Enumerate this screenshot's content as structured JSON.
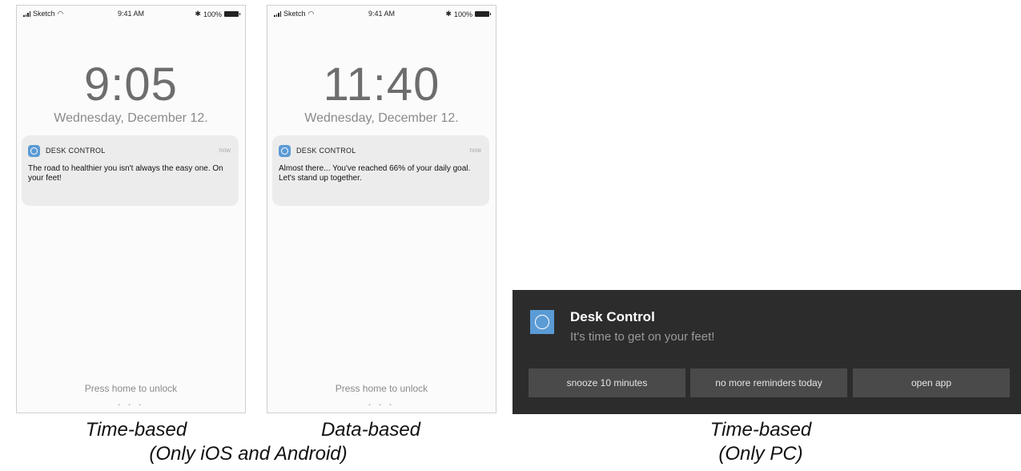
{
  "phones": [
    {
      "status": {
        "carrier": "Sketch",
        "time": "9:41 AM",
        "battery": "100%"
      },
      "lock_time": "9:05",
      "lock_date": "Wednesday, December 12.",
      "notification": {
        "app_name": "DESK CONTROL",
        "time": "now",
        "body": "The road to healthier you isn't always the easy one. On your feet!"
      },
      "unlock_hint": "Press home to unlock",
      "page_dots": "• • •"
    },
    {
      "status": {
        "carrier": "Sketch",
        "time": "9:41 AM",
        "battery": "100%"
      },
      "lock_time": "11:40",
      "lock_date": "Wednesday, December 12.",
      "notification": {
        "app_name": "DESK CONTROL",
        "time": "now",
        "body": "Almost there... You've reached 66% of your daily goal. Let's stand up together."
      },
      "unlock_hint": "Press home to unlock",
      "page_dots": "• • •"
    }
  ],
  "pc_notification": {
    "title": "Desk Control",
    "message": "It's time to get on your feet!",
    "buttons": [
      "snooze 10 minutes",
      "no more reminders today",
      "open app"
    ]
  },
  "captions": {
    "phone_1": "Time-based",
    "phone_2": "Data-based",
    "mobile_note": "(Only iOS and Android)",
    "pc": "Time-based",
    "pc_note": "(Only PC)"
  },
  "colors": {
    "accent": "#5b9bd5",
    "toast_bg": "#2c2c2c",
    "toast_button": "#4a4a4a"
  },
  "icons": {
    "status": [
      "signal-icon",
      "wifi-icon",
      "bluetooth-icon",
      "battery-icon"
    ],
    "app": "desk-control-app-icon"
  }
}
